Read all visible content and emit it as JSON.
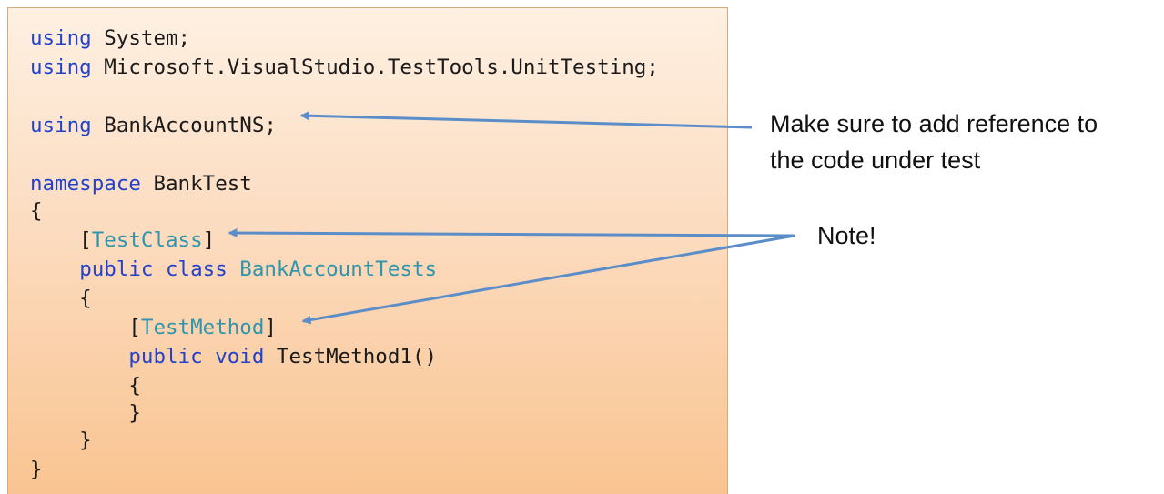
{
  "code": {
    "lines": [
      [
        {
          "t": "using",
          "k": "kw"
        },
        {
          "t": " System;",
          "k": "pl"
        }
      ],
      [
        {
          "t": "using",
          "k": "kw"
        },
        {
          "t": " Microsoft.VisualStudio.TestTools.UnitTesting;",
          "k": "pl"
        }
      ],
      [],
      [
        {
          "t": "using",
          "k": "kw"
        },
        {
          "t": " BankAccountNS;",
          "k": "pl"
        }
      ],
      [],
      [
        {
          "t": "namespace",
          "k": "kw"
        },
        {
          "t": " BankTest",
          "k": "pl"
        }
      ],
      [
        {
          "t": "{",
          "k": "pl"
        }
      ],
      [
        {
          "t": "    [",
          "k": "pl"
        },
        {
          "t": "TestClass",
          "k": "ty"
        },
        {
          "t": "]",
          "k": "pl"
        }
      ],
      [
        {
          "t": "    ",
          "k": "pl"
        },
        {
          "t": "public",
          "k": "kw"
        },
        {
          "t": " ",
          "k": "pl"
        },
        {
          "t": "class",
          "k": "kw"
        },
        {
          "t": " ",
          "k": "pl"
        },
        {
          "t": "BankAccountTests",
          "k": "ty"
        }
      ],
      [
        {
          "t": "    {",
          "k": "pl"
        }
      ],
      [
        {
          "t": "        [",
          "k": "pl"
        },
        {
          "t": "TestMethod",
          "k": "ty"
        },
        {
          "t": "]",
          "k": "pl"
        }
      ],
      [
        {
          "t": "        ",
          "k": "pl"
        },
        {
          "t": "public",
          "k": "kw"
        },
        {
          "t": " ",
          "k": "pl"
        },
        {
          "t": "void",
          "k": "kw"
        },
        {
          "t": " TestMethod1()",
          "k": "pl"
        }
      ],
      [
        {
          "t": "        {",
          "k": "pl"
        }
      ],
      [
        {
          "t": "        }",
          "k": "pl"
        }
      ],
      [
        {
          "t": "    }",
          "k": "pl"
        }
      ],
      [
        {
          "t": "}",
          "k": "pl"
        }
      ]
    ]
  },
  "annotations": {
    "reference_note_line1": "Make sure to add reference to",
    "reference_note_line2": "the code under test",
    "attribute_note": "Note!"
  },
  "colors": {
    "keyword": "#2142c9",
    "type_name": "#2e95ac",
    "plain_text": "#1a1a1a",
    "arrow": "#5b8ec9",
    "panel_top": "#fef0e2",
    "panel_bottom": "#f9c491"
  }
}
